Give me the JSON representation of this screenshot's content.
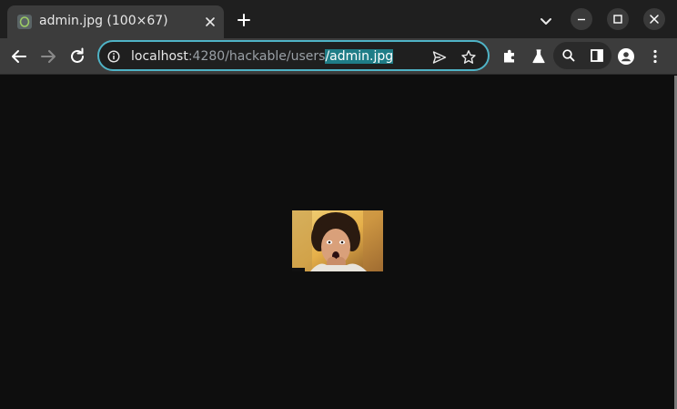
{
  "tab": {
    "title": "admin.jpg (100×67)",
    "favicon": "image-favicon-icon"
  },
  "toolbar": {
    "url_host": "localhost",
    "url_rest": ":4280/hackable/users",
    "url_selected": "/admin.jpg"
  },
  "content": {
    "image_alt": "admin.jpg"
  },
  "colors": {
    "tabstrip_bg": "#1f1f1f",
    "toolbar_bg": "#3c3c3c",
    "omnibox_border": "#4fb3c6",
    "selection": "#1f7d87",
    "page_bg": "#0e0e0e"
  }
}
